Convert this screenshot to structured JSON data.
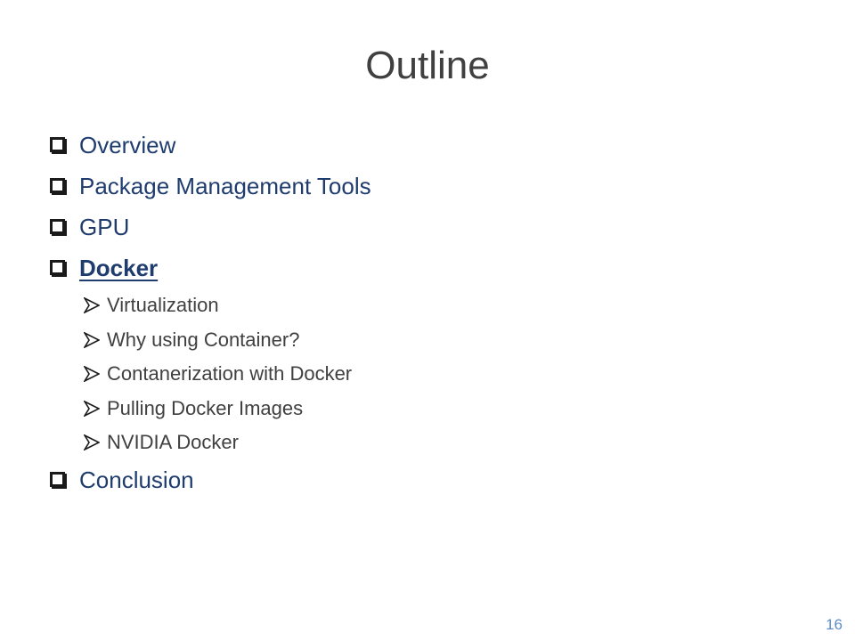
{
  "slide": {
    "title": "Outline",
    "page_number": "16",
    "colors": {
      "title": "#404040",
      "main_item": "#1f3c6e",
      "sub_item": "#404040",
      "page_number": "#5b8cc8"
    },
    "items": [
      {
        "label": "Overview",
        "active": false
      },
      {
        "label": "Package Management Tools",
        "active": false
      },
      {
        "label": "GPU",
        "active": false
      },
      {
        "label": "Docker",
        "active": true,
        "subitems": [
          "Virtualization",
          "Why using Container?",
          "Contanerization with Docker",
          "Pulling Docker Images",
          "NVIDIA Docker"
        ]
      },
      {
        "label": "Conclusion",
        "active": false
      }
    ]
  }
}
